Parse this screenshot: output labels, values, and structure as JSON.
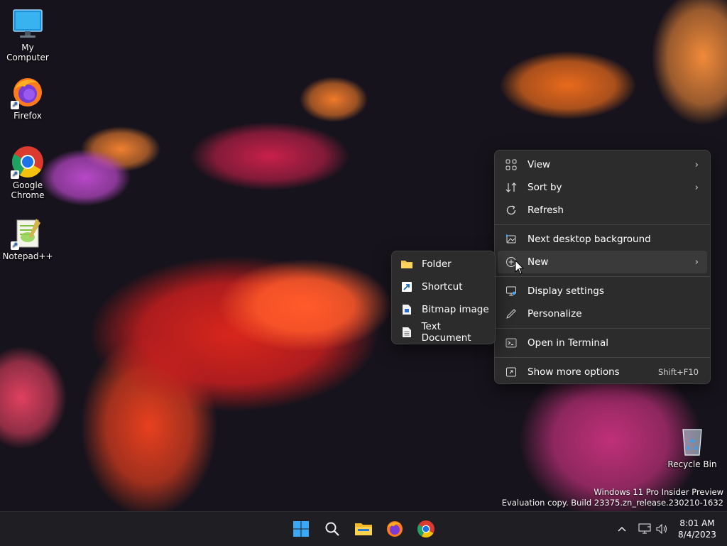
{
  "desktop": {
    "icons": [
      {
        "label": "My Computer",
        "icon": "monitor-icon"
      },
      {
        "label": "Firefox",
        "icon": "firefox-icon"
      },
      {
        "label": "Google Chrome",
        "icon": "chrome-icon"
      },
      {
        "label": "Notepad++",
        "icon": "notepadpp-icon"
      },
      {
        "label": "Recycle Bin",
        "icon": "recycle-bin-icon"
      }
    ]
  },
  "context_menu": {
    "items": [
      {
        "label": "View",
        "icon": "grid-icon",
        "submenu": true
      },
      {
        "label": "Sort by",
        "icon": "sort-icon",
        "submenu": true
      },
      {
        "label": "Refresh",
        "icon": "refresh-icon"
      },
      {
        "label": "Next desktop background",
        "icon": "image-next-icon"
      },
      {
        "label": "New",
        "icon": "plus-circle-icon",
        "submenu": true,
        "active": true
      },
      {
        "label": "Display settings",
        "icon": "display-icon"
      },
      {
        "label": "Personalize",
        "icon": "pen-icon"
      },
      {
        "label": "Open in Terminal",
        "icon": "terminal-icon"
      },
      {
        "label": "Show more options",
        "icon": "more-options-icon",
        "shortcut": "Shift+F10"
      }
    ]
  },
  "new_submenu": {
    "items": [
      {
        "label": "Folder",
        "icon": "folder-icon"
      },
      {
        "label": "Shortcut",
        "icon": "shortcut-icon"
      },
      {
        "label": "Bitmap image",
        "icon": "bitmap-icon"
      },
      {
        "label": "Text Document",
        "icon": "text-document-icon"
      }
    ]
  },
  "watermark": {
    "line1": "Windows 11 Pro Insider Preview",
    "line2": "Evaluation copy. Build 23375.zn_release.230210-1632"
  },
  "taskbar": {
    "apps": [
      "start-icon",
      "search-icon",
      "file-explorer-icon",
      "firefox-icon",
      "chrome-icon"
    ],
    "clock": {
      "time": "8:01 AM",
      "date": "8/4/2023"
    }
  },
  "colors": {
    "menu_bg": "#2c2c2c",
    "taskbar_bg": "#1f1f23",
    "accent": "#0078d4"
  }
}
